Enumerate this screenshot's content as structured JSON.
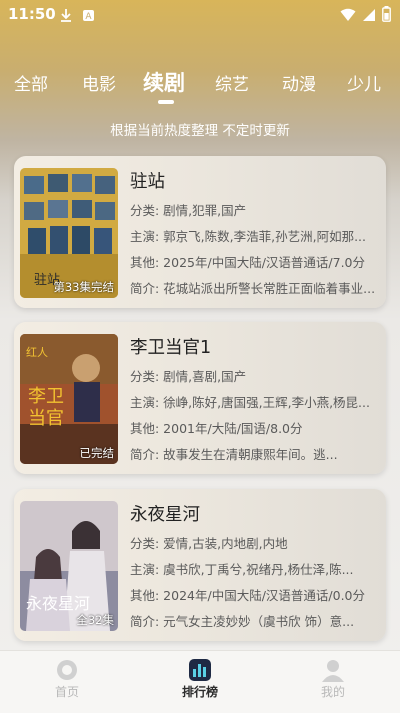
{
  "status": {
    "time": "11:50"
  },
  "tabs": [
    "全部",
    "电影",
    "续剧",
    "综艺",
    "动漫",
    "少儿"
  ],
  "subtitle": "根据当前热度整理 不定时更新",
  "cards": [
    {
      "title": "驻站",
      "badge": "第33集完结",
      "category": "分类:  剧情,犯罪,国产",
      "cast": "主演:  郭京飞,陈数,李浩菲,孙艺洲,阿如那...",
      "other": "其他:  2025年/中国大陆/汉语普通话/7.0分",
      "intro": "简介:  花城站派出所警长常胜正面临着事业..."
    },
    {
      "title": "李卫当官1",
      "badge": "已完结",
      "category": "分类:  剧情,喜剧,国产",
      "cast": "主演:  徐峥,陈好,唐国强,王辉,李小燕,杨昆...",
      "other": "其他:  2001年/大陆/国语/8.0分",
      "intro": "简介:      故事发生在清朝康熙年间。逃..."
    },
    {
      "title": "永夜星河",
      "badge": "全32集",
      "category": "分类:  爱情,古装,内地剧,内地",
      "cast": "主演:  虞书欣,丁禹兮,祝绪丹,杨仕泽,陈...",
      "other": "其他:  2024年/中国大陆/汉语普通话/0.0分",
      "intro": "简介:  元气女主凌妙妙（虞书欣 饰）意..."
    }
  ],
  "nav": [
    "首页",
    "排行榜",
    "我的"
  ]
}
